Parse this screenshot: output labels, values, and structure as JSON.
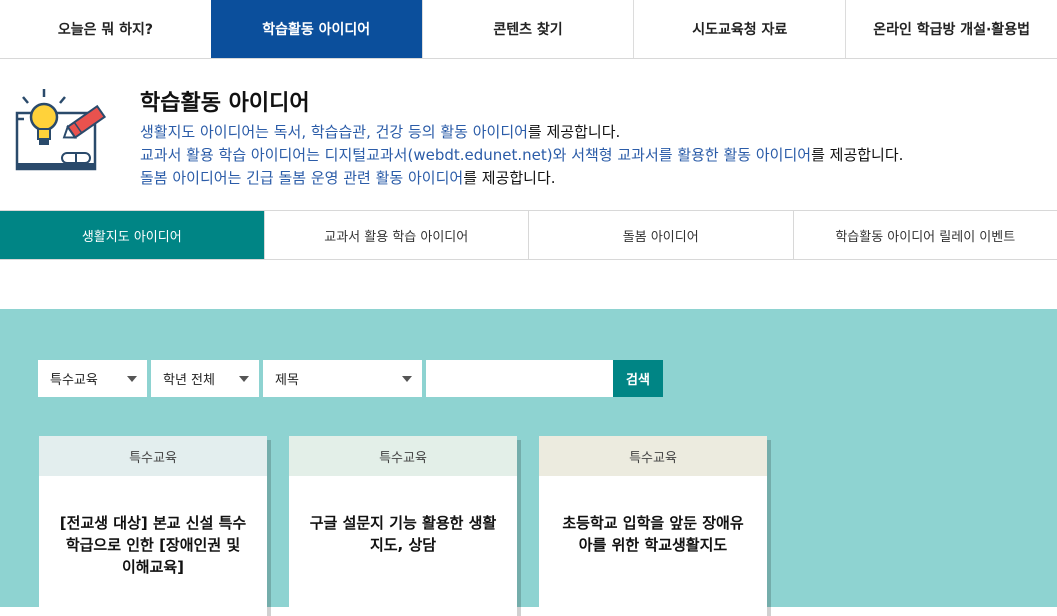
{
  "topnav": {
    "items": [
      "오늘은 뭐 하지?",
      "학습활동 아이디어",
      "콘텐츠 찾기",
      "시도교육청 자료",
      "온라인 학급방 개설·활용법"
    ],
    "active_index": 1
  },
  "intro": {
    "title": "학습활동 아이디어",
    "line1_highlight": "생활지도 아이디어는 독서, 학습습관, 건강 등의 활동 아이디어",
    "line1_rest": "를 제공합니다.",
    "line2_highlight": "교과서 활용 학습 아이디어는 디지털교과서(webdt.edunet.net)와 서책형 교과서를 활용한 활동 아이디어",
    "line2_rest": "를 제공합니다.",
    "line3_highlight": "돌봄 아이디어는 긴급 돌봄 운영 관련 활동 아이디어",
    "line3_rest": "를 제공합니다."
  },
  "subtabs": {
    "items": [
      "생활지도 아이디어",
      "교과서 활용 학습 아이디어",
      "돌봄 아이디어",
      "학습활동 아이디어 릴레이 이벤트"
    ],
    "active_index": 0
  },
  "search": {
    "category": "특수교육",
    "grade": "학년 전체",
    "field": "제목",
    "keyword": "",
    "button": "검색"
  },
  "cards": [
    {
      "category": "특수교육",
      "title": "[전교생 대상] 본교 신설 특수학급으로 인한 [장애인권 및 이해교육]"
    },
    {
      "category": "특수교육",
      "title": "구글 설문지 기능 활용한 생활지도, 상담"
    },
    {
      "category": "특수교육",
      "title": "초등학교 입학을 앞둔 장애유아를 위한 학교생활지도"
    }
  ],
  "colors": {
    "nav_active": "#0b4f9c",
    "tab_active": "#008585",
    "board_bg": "#8ed3d1",
    "highlight_text": "#2b5ca8"
  }
}
